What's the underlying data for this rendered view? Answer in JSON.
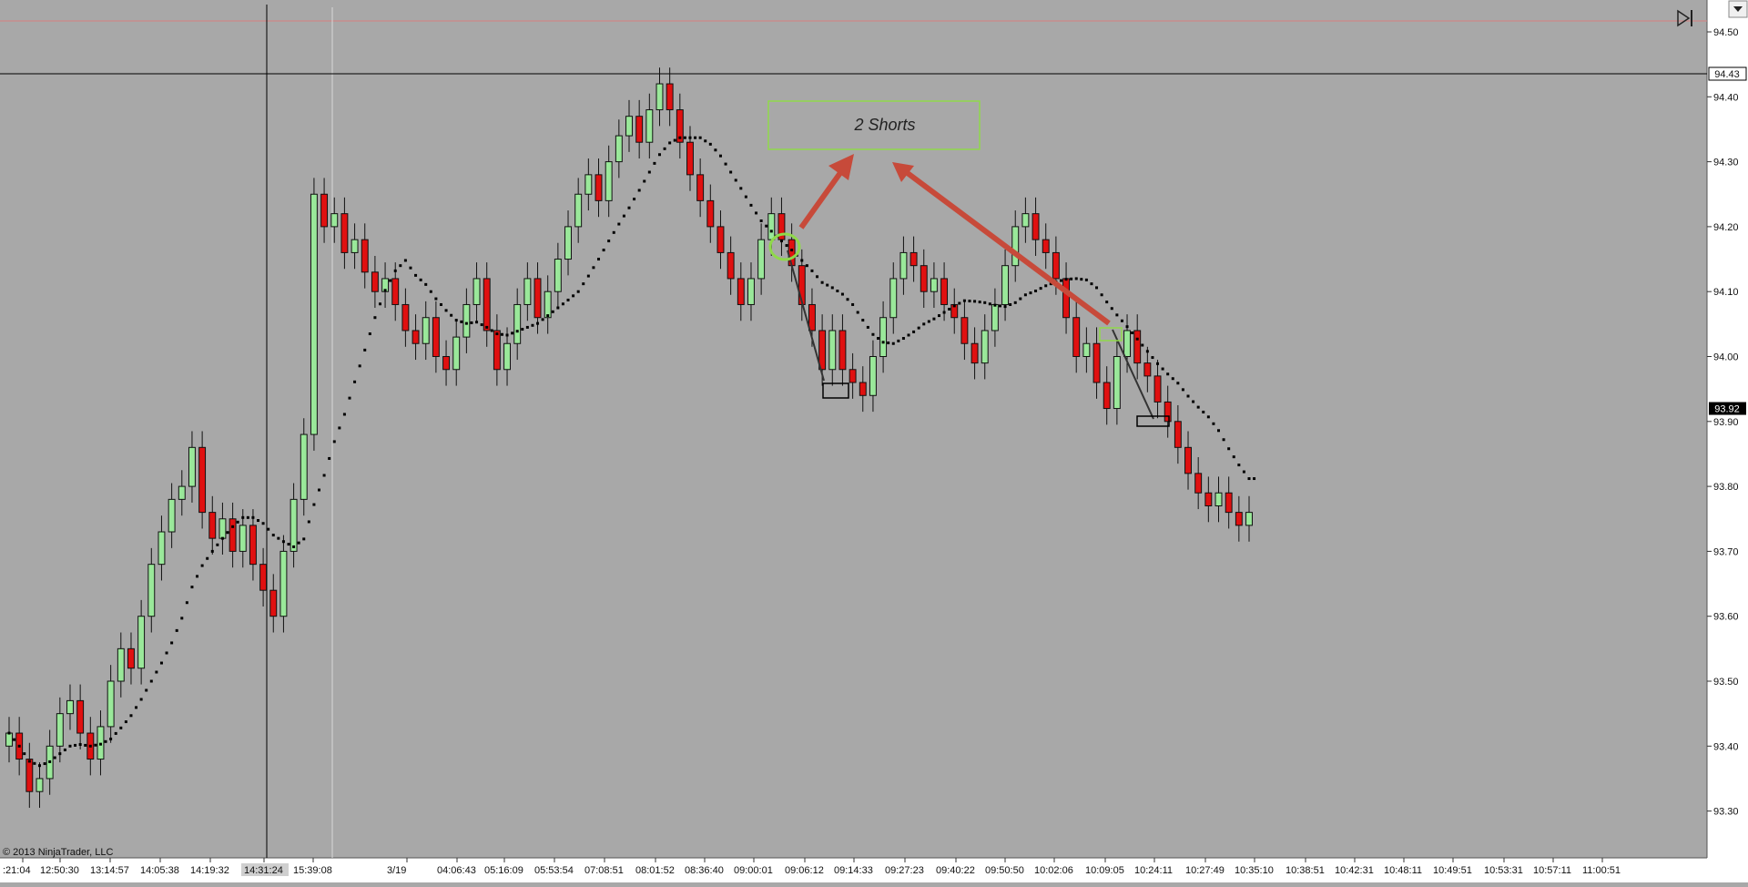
{
  "copyright": "© 2013 NinjaTrader, LLC",
  "chart_data": {
    "type": "candlestick",
    "ylim": [
      93.25,
      94.52
    ],
    "yticks": [
      "94.50",
      "94.40",
      "94.30",
      "94.20",
      "94.10",
      "94.00",
      "93.90",
      "93.80",
      "93.70",
      "93.60",
      "93.50",
      "93.40",
      "93.30"
    ],
    "last_price": "93.92",
    "crosshair_price": "94.43",
    "time_labels": [
      ":21:04",
      "12:50:30",
      "13:14:57",
      "14:05:38",
      "14:19:32",
      "14:31:24",
      "15:39:08",
      "3/19",
      "04:06:43",
      "05:16:09",
      "05:53:54",
      "07:08:51",
      "08:01:52",
      "08:36:40",
      "09:00:01",
      "09:06:12",
      "09:14:33",
      "09:27:23",
      "09:40:22",
      "09:50:50",
      "10:02:06",
      "10:09:05",
      "10:24:11",
      "10:27:49",
      "10:35:10",
      "10:38:51",
      "10:42:31",
      "10:48:11",
      "10:49:51",
      "10:53:31",
      "10:57:11",
      "11:00:51"
    ],
    "closes": [
      93.42,
      93.38,
      93.33,
      93.35,
      93.4,
      93.45,
      93.47,
      93.42,
      93.38,
      93.43,
      93.5,
      93.55,
      93.52,
      93.6,
      93.68,
      93.73,
      93.78,
      93.8,
      93.86,
      93.76,
      93.72,
      93.75,
      93.7,
      93.74,
      93.68,
      93.64,
      93.6,
      93.7,
      93.78,
      93.88,
      94.25,
      94.2,
      94.22,
      94.16,
      94.18,
      94.13,
      94.1,
      94.12,
      94.08,
      94.04,
      94.02,
      94.06,
      94.0,
      93.98,
      94.03,
      94.08,
      94.12,
      94.04,
      93.98,
      94.02,
      94.08,
      94.12,
      94.06,
      94.1,
      94.15,
      94.2,
      94.25,
      94.28,
      94.24,
      94.3,
      94.34,
      94.37,
      94.33,
      94.38,
      94.42,
      94.38,
      94.33,
      94.28,
      94.24,
      94.2,
      94.16,
      94.12,
      94.08,
      94.12,
      94.18,
      94.22,
      94.18,
      94.14,
      94.08,
      94.04,
      93.98,
      94.04,
      93.98,
      93.96,
      93.94,
      94.0,
      94.06,
      94.12,
      94.16,
      94.14,
      94.1,
      94.12,
      94.08,
      94.06,
      94.02,
      93.99,
      94.04,
      94.08,
      94.14,
      94.2,
      94.22,
      94.18,
      94.16,
      94.12,
      94.06,
      94.0,
      94.02,
      93.96,
      93.92,
      94.0,
      94.04,
      93.99,
      93.97,
      93.93,
      93.9,
      93.86,
      93.82,
      93.79,
      93.77,
      93.79,
      93.76,
      93.74,
      93.76
    ],
    "moving_average": {
      "name": "",
      "color": "#000000"
    },
    "annotation": {
      "text": "2 Shorts"
    }
  }
}
